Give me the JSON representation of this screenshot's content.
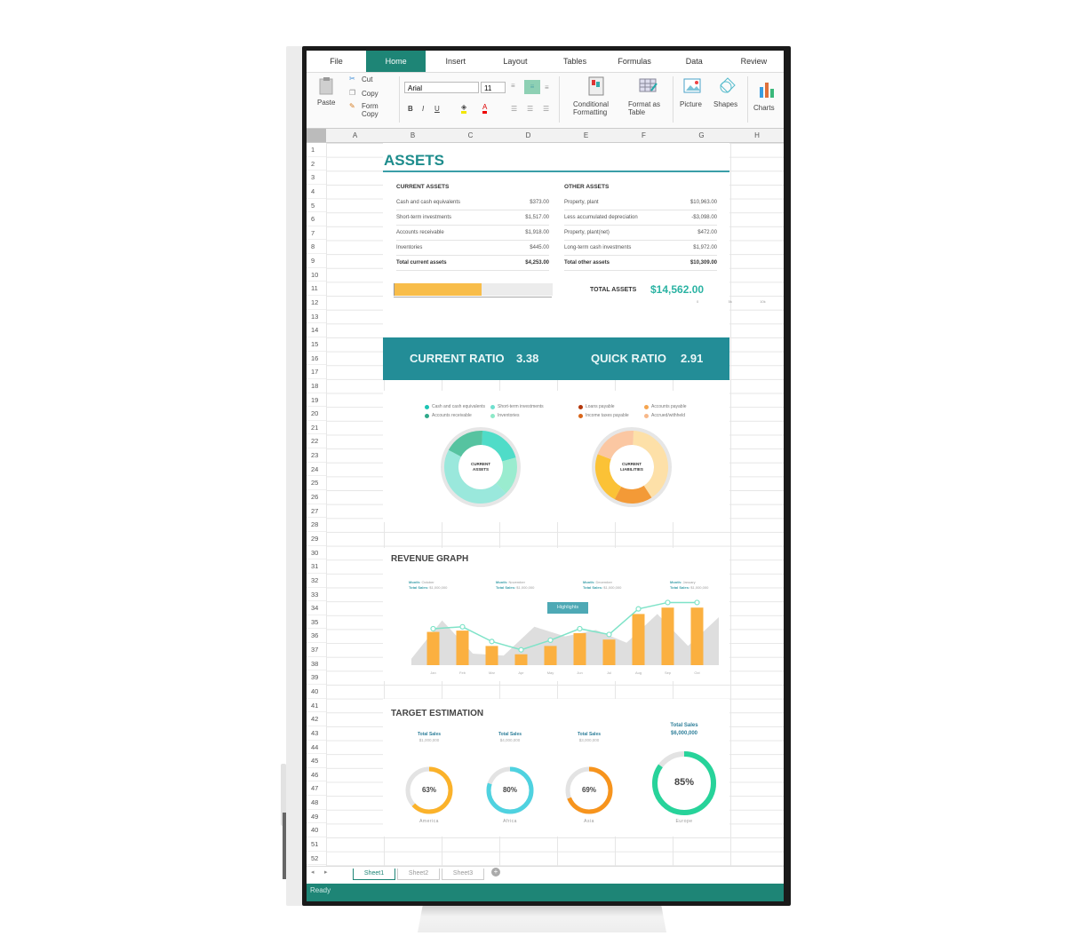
{
  "menu": {
    "tabs": [
      "File",
      "Home",
      "Insert",
      "Layout",
      "Tables",
      "Formulas",
      "Data",
      "Review"
    ],
    "active_tab": "Home"
  },
  "ribbon": {
    "paste": "Paste",
    "cut": "Cut",
    "copy": "Copy",
    "format_copy_1": "Form",
    "format_copy_2": "Copy",
    "font_name": "Arial",
    "font_size": "11",
    "conditional_1": "Conditional",
    "conditional_2": "Formatting",
    "format_table_1": "Format as",
    "format_table_2": "Table",
    "picture": "Picture",
    "shapes": "Shapes",
    "charts": "Charts"
  },
  "columns": [
    "A",
    "B",
    "C",
    "D",
    "E",
    "F",
    "G",
    "H"
  ],
  "rows": [
    "1",
    "2",
    "3",
    "4",
    "5",
    "6",
    "7",
    "8",
    "9",
    "10",
    "11",
    "12",
    "13",
    "14",
    "15",
    "16",
    "17",
    "18",
    "19",
    "20",
    "21",
    "22",
    "23",
    "24",
    "25",
    "26",
    "27",
    "28",
    "29",
    "30",
    "31",
    "32",
    "33",
    "34",
    "35",
    "36",
    "37",
    "38",
    "39",
    "40",
    "41",
    "42",
    "43",
    "44",
    "45",
    "46",
    "47",
    "48",
    "49",
    "40",
    "51",
    "52"
  ],
  "assets": {
    "title": "ASSETS",
    "current": {
      "heading": "CURRENT ASSETS",
      "rows": [
        {
          "label": "Cash and cash equivalents",
          "value": "$373.00"
        },
        {
          "label": "Short-term investments",
          "value": "$1,517.00"
        },
        {
          "label": "Accounts receivable",
          "value": "$1,918.00"
        },
        {
          "label": "Inventories",
          "value": "$445.00"
        }
      ],
      "total": {
        "label": "Total current assets",
        "value": "$4,253.00"
      }
    },
    "other": {
      "heading": "OTHER ASSETS",
      "rows": [
        {
          "label": "Property, plant",
          "value": "$10,963.00"
        },
        {
          "label": "Less accumulated depreciation",
          "value": "-$3,098.00"
        },
        {
          "label": "Property, plant(net)",
          "value": "$472.00"
        },
        {
          "label": "Long-term cash investments",
          "value": "$1,972.00"
        }
      ],
      "total": {
        "label": "Total other assets",
        "value": "$10,309.00"
      }
    },
    "progress_fraction": 0.55,
    "progress_ticks": [
      "0",
      "5k",
      "10k",
      "15k",
      "20k",
      "25k"
    ],
    "total_label": "TOTAL ASSETS",
    "total_value": "$14,562.00"
  },
  "ratios": {
    "current_label": "CURRENT RATIO",
    "current_value": "3.38",
    "quick_label": "QUICK RATIO",
    "quick_value": "2.91"
  },
  "donuts": {
    "assets": {
      "center": [
        "CURRENT",
        "ASSETS"
      ],
      "legend": [
        {
          "label": "Cash and cash equivalents",
          "color": "#1cc4b4"
        },
        {
          "label": "Short-term investments",
          "color": "#6fe0cf"
        },
        {
          "label": "Accounts receivable",
          "color": "#2fa98a"
        },
        {
          "label": "Inventories",
          "color": "#8de9c8"
        }
      ],
      "slices": [
        {
          "value": 20,
          "color": "#4fdcc8"
        },
        {
          "value": 17,
          "color": "#9aeccf"
        },
        {
          "value": 45,
          "color": "#9ae8dc"
        },
        {
          "value": 18,
          "color": "#56c3a0"
        }
      ]
    },
    "liabilities": {
      "center": [
        "CURRENT",
        "LIABILITIES"
      ],
      "legend": [
        {
          "label": "Loans payable",
          "color": "#b3360a"
        },
        {
          "label": "Accounts payable",
          "color": "#f5a54f"
        },
        {
          "label": "Income taxes payable",
          "color": "#d9661a"
        },
        {
          "label": "Accrued/withheld",
          "color": "#f7b88a"
        }
      ],
      "slices": [
        {
          "value": 40,
          "color": "#fde0a8"
        },
        {
          "value": 17,
          "color": "#f39a37"
        },
        {
          "value": 23,
          "color": "#fbc236"
        },
        {
          "value": 20,
          "color": "#fbc7a2"
        }
      ]
    }
  },
  "revenue": {
    "title": "REVENUE GRAPH",
    "highlights_label": "Highlights",
    "annotations": [
      {
        "month_label": "Month:",
        "month": "October",
        "sales_label": "Total Sales:",
        "sales": "$1,000,000"
      },
      {
        "month_label": "Month:",
        "month": "November",
        "sales_label": "Total Sales:",
        "sales": "$1,000,000"
      },
      {
        "month_label": "Month:",
        "month": "December",
        "sales_label": "Total Sales:",
        "sales": "$1,000,000"
      },
      {
        "month_label": "Month:",
        "month": "January",
        "sales_label": "Total Sales:",
        "sales": "$1,000,000"
      }
    ]
  },
  "chart_data": {
    "type": "bar",
    "title": "REVENUE GRAPH",
    "categories": [
      "Jan",
      "Feb",
      "Mar",
      "Apr",
      "May",
      "Jun",
      "Jul",
      "Aug",
      "Sep",
      "Oct"
    ],
    "series": [
      {
        "name": "Bars",
        "type": "bar",
        "color": "#fbb040",
        "values": [
          52,
          54,
          30,
          17,
          30,
          50,
          40,
          80,
          90,
          90
        ]
      },
      {
        "name": "Line",
        "type": "line",
        "color": "#7fe3c8",
        "values": [
          57,
          60,
          37,
          24,
          39,
          57,
          48,
          88,
          98,
          98
        ]
      },
      {
        "name": "Area",
        "type": "area",
        "color": "#dedede",
        "values": [
          10,
          70,
          18,
          15,
          60,
          45,
          55,
          35,
          80,
          30,
          75
        ]
      }
    ],
    "ylim": [
      0,
      100
    ],
    "grid": false
  },
  "target": {
    "title": "TARGET ESTIMATION",
    "items": [
      {
        "sales_label": "Total Sales",
        "sales": "$1,000,000",
        "percent_text": "63%",
        "percent": 63,
        "region": "America",
        "color": "#fbb22a"
      },
      {
        "sales_label": "Total Sales",
        "sales": "$4,000,000",
        "percent_text": "80%",
        "percent": 80,
        "region": "Africa",
        "color": "#4fd2e0"
      },
      {
        "sales_label": "Total Sales",
        "sales": "$3,000,000",
        "percent_text": "69%",
        "percent": 69,
        "region": "Asia",
        "color": "#f7941d"
      },
      {
        "sales_label": "Total Sales",
        "sales": "$6,000,000",
        "percent_text": "85%",
        "percent": 85,
        "region": "Europe",
        "color": "#27d39a"
      }
    ]
  },
  "sheets": [
    "Sheet1",
    "Sheet2",
    "Sheet3"
  ],
  "active_sheet": "Sheet1",
  "status": "Ready"
}
